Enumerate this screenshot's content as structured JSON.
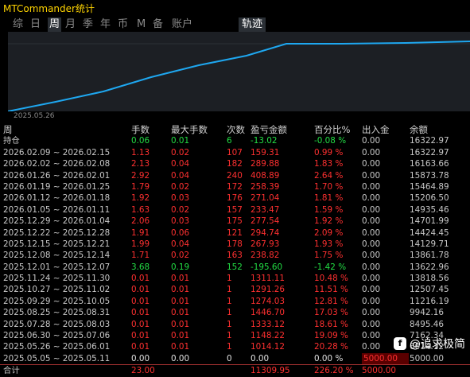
{
  "app_title": "MTCommander统计",
  "tabs": [
    "综",
    "日",
    "周",
    "月",
    "季",
    "年",
    "币",
    "M",
    "备",
    "账户"
  ],
  "active_tab": "周",
  "trace_tab": "轨迹",
  "chart": {
    "start_date": "2025.05.26",
    "line_color": "#1ea7f0"
  },
  "columns": [
    "周",
    "手数",
    "最大手数",
    "次数",
    "盈亏金额",
    "百分比%",
    "出入金",
    "余额"
  ],
  "rows": [
    {
      "week": "持仓",
      "lots": "0.06",
      "max": "0.01",
      "count": "6",
      "pnl": "-13.02",
      "pct": "-0.08 %",
      "io": "0.00",
      "bal": "16322.97",
      "c": "green"
    },
    {
      "week": "2026.02.09 ~ 2026.02.15",
      "lots": "1.13",
      "max": "0.02",
      "count": "107",
      "pnl": "159.31",
      "pct": "0.99 %",
      "io": "0.00",
      "bal": "16322.97",
      "c": "red"
    },
    {
      "week": "2026.02.02 ~ 2026.02.08",
      "lots": "2.13",
      "max": "0.04",
      "count": "182",
      "pnl": "289.88",
      "pct": "1.83 %",
      "io": "0.00",
      "bal": "16163.66",
      "c": "red"
    },
    {
      "week": "2026.01.26 ~ 2026.02.01",
      "lots": "2.92",
      "max": "0.04",
      "count": "240",
      "pnl": "408.89",
      "pct": "2.64 %",
      "io": "0.00",
      "bal": "15873.78",
      "c": "red"
    },
    {
      "week": "2026.01.19 ~ 2026.01.25",
      "lots": "1.79",
      "max": "0.02",
      "count": "172",
      "pnl": "258.39",
      "pct": "1.70 %",
      "io": "0.00",
      "bal": "15464.89",
      "c": "red"
    },
    {
      "week": "2026.01.12 ~ 2026.01.18",
      "lots": "1.92",
      "max": "0.03",
      "count": "176",
      "pnl": "271.04",
      "pct": "1.81 %",
      "io": "0.00",
      "bal": "15206.50",
      "c": "red"
    },
    {
      "week": "2026.01.05 ~ 2026.01.11",
      "lots": "1.63",
      "max": "0.02",
      "count": "157",
      "pnl": "233.47",
      "pct": "1.59 %",
      "io": "0.00",
      "bal": "14935.46",
      "c": "red"
    },
    {
      "week": "2025.12.29 ~ 2026.01.04",
      "lots": "2.06",
      "max": "0.03",
      "count": "175",
      "pnl": "277.54",
      "pct": "1.92 %",
      "io": "0.00",
      "bal": "14701.99",
      "c": "red"
    },
    {
      "week": "2025.12.22 ~ 2025.12.28",
      "lots": "1.91",
      "max": "0.06",
      "count": "121",
      "pnl": "294.74",
      "pct": "2.09 %",
      "io": "0.00",
      "bal": "14424.45",
      "c": "red"
    },
    {
      "week": "2025.12.15 ~ 2025.12.21",
      "lots": "1.99",
      "max": "0.04",
      "count": "178",
      "pnl": "267.93",
      "pct": "1.93 %",
      "io": "0.00",
      "bal": "14129.71",
      "c": "red"
    },
    {
      "week": "2025.12.08 ~ 2025.12.14",
      "lots": "1.71",
      "max": "0.02",
      "count": "163",
      "pnl": "238.82",
      "pct": "1.75 %",
      "io": "0.00",
      "bal": "13861.78",
      "c": "red"
    },
    {
      "week": "2025.12.01 ~ 2025.12.07",
      "lots": "3.68",
      "max": "0.19",
      "count": "152",
      "pnl": "-195.60",
      "pct": "-1.42 %",
      "io": "0.00",
      "bal": "13622.96",
      "c": "green"
    },
    {
      "week": "2025.11.24 ~ 2025.11.30",
      "lots": "0.01",
      "max": "0.01",
      "count": "1",
      "pnl": "1311.11",
      "pct": "10.48 %",
      "io": "0.00",
      "bal": "13818.56",
      "c": "red"
    },
    {
      "week": "2025.10.27 ~ 2025.11.02",
      "lots": "0.01",
      "max": "0.01",
      "count": "1",
      "pnl": "1291.26",
      "pct": "11.51 %",
      "io": "0.00",
      "bal": "12507.45",
      "c": "red"
    },
    {
      "week": "2025.09.29 ~ 2025.10.05",
      "lots": "0.01",
      "max": "0.01",
      "count": "1",
      "pnl": "1274.03",
      "pct": "12.81 %",
      "io": "0.00",
      "bal": "11216.19",
      "c": "red"
    },
    {
      "week": "2025.08.25 ~ 2025.08.31",
      "lots": "0.01",
      "max": "0.01",
      "count": "1",
      "pnl": "1446.70",
      "pct": "17.03 %",
      "io": "0.00",
      "bal": "9942.16",
      "c": "red"
    },
    {
      "week": "2025.07.28 ~ 2025.08.03",
      "lots": "0.01",
      "max": "0.01",
      "count": "1",
      "pnl": "1333.12",
      "pct": "18.61 %",
      "io": "0.00",
      "bal": "8495.46",
      "c": "red"
    },
    {
      "week": "2025.06.30 ~ 2025.07.06",
      "lots": "0.01",
      "max": "0.01",
      "count": "1",
      "pnl": "1148.22",
      "pct": "19.09 %",
      "io": "0.00",
      "bal": "7162.34",
      "c": "red"
    },
    {
      "week": "2025.05.26 ~ 2025.06.01",
      "lots": "0.01",
      "max": "0.01",
      "count": "1",
      "pnl": "1014.12",
      "pct": "20.28 %",
      "io": "0.00",
      "bal": "6014.12",
      "c": "red"
    },
    {
      "week": "2025.05.05 ~ 2025.05.11",
      "lots": "0.00",
      "max": "0.00",
      "count": "0",
      "pnl": "0.00",
      "pct": "0.00 %",
      "io": "5000.00",
      "bal": "5000.00",
      "c": "white",
      "io_red": true
    }
  ],
  "total": {
    "week": "合计",
    "lots": "23.00",
    "max": "",
    "count": "",
    "pnl": "11309.95",
    "pct": "226.20 %",
    "io": "5000.00",
    "bal": ""
  },
  "watermark": "@追求极简"
}
